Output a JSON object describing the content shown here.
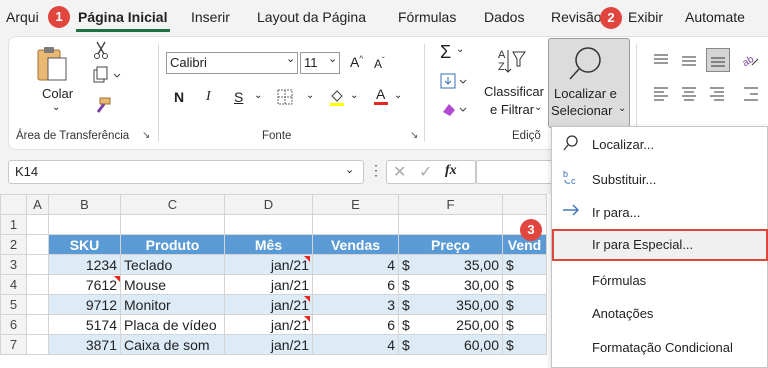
{
  "tabs": [
    "Arqui",
    "Página Inicial",
    "Inserir",
    "Layout da Página",
    "Fórmulas",
    "Dados",
    "Revisão",
    "Exibir",
    "Automate"
  ],
  "active_tab": "Página Inicial",
  "badges": [
    "1",
    "2",
    "3"
  ],
  "ribbon": {
    "paste_label": "Colar",
    "clipboard_group": "Área de Transferência",
    "font_name": "Calibri",
    "font_size": "11",
    "font_group": "Fonte",
    "bold": "N",
    "italic": "I",
    "underline": "S",
    "sort_filter": [
      "Classificar",
      "e Filtrar"
    ],
    "find_select": [
      "Localizar e",
      "Selecionar"
    ],
    "editing_group": "Ediçõ"
  },
  "formula_bar": {
    "name_box": "K14",
    "fx": "fx"
  },
  "sheet": {
    "columns": [
      "A",
      "B",
      "C",
      "D",
      "E",
      "F"
    ],
    "row_numbers": [
      "1",
      "2",
      "3",
      "4",
      "5",
      "6",
      "7"
    ],
    "headers": [
      "SKU",
      "Produto",
      "Mês",
      "Vendas",
      "Preço",
      "Vend"
    ],
    "rows": [
      {
        "sku": "1234",
        "produto": "Teclado",
        "mes": "jan/21",
        "vendas": "4",
        "cur": "$",
        "preco": "35,00",
        "v": "$"
      },
      {
        "sku": "7612",
        "produto": "Mouse",
        "mes": "jan/21",
        "vendas": "6",
        "cur": "$",
        "preco": "30,00",
        "v": "$"
      },
      {
        "sku": "9712",
        "produto": "Monitor",
        "mes": "jan/21",
        "vendas": "3",
        "cur": "$",
        "preco": "350,00",
        "v": "$"
      },
      {
        "sku": "5174",
        "produto": "Placa de vídeo",
        "mes": "jan/21",
        "vendas": "6",
        "cur": "$",
        "preco": "250,00",
        "v": "$"
      },
      {
        "sku": "3871",
        "produto": "Caixa de som",
        "mes": "jan/21",
        "vendas": "4",
        "cur": "$",
        "preco": "60,00",
        "v": "$"
      }
    ]
  },
  "menu": {
    "items": [
      "Localizar...",
      "Substituir...",
      "Ir para...",
      "Ir para Especial...",
      "Fórmulas",
      "Anotações",
      "Formatação Condicional"
    ]
  },
  "colors": {
    "accent": "#1e7145",
    "header_fill": "#5b9bd5",
    "band_fill": "#ddebf7",
    "badge": "#e0463e"
  }
}
